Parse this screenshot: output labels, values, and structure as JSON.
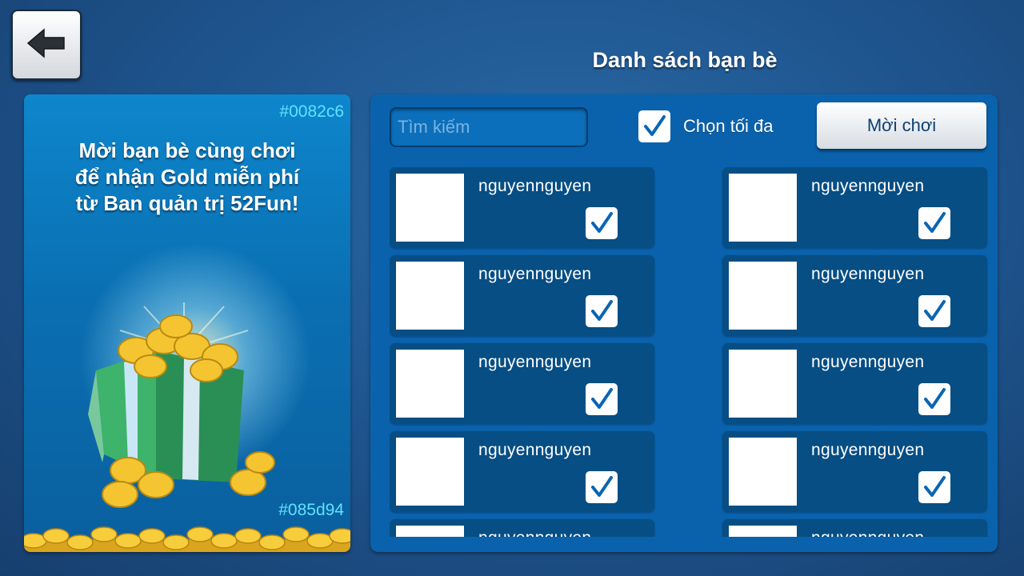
{
  "header": {
    "title": "Danh sách bạn bè",
    "back_icon": "arrow-left-icon"
  },
  "promo": {
    "hex_top": "#0082c6",
    "hex_bottom": "#085d94",
    "message_lines": [
      "Mời bạn bè cùng chơi",
      "để nhận Gold miễn phí",
      "từ Ban quản trị 52Fun!"
    ],
    "illustration": "gift-box-with-gold-coins"
  },
  "toolbar": {
    "search_placeholder": "Tìm kiếm",
    "select_all_label": "Chọn tối đa",
    "select_all_checked": true,
    "invite_label": "Mời chơi"
  },
  "colors": {
    "background": "#1f5690",
    "panel": "#0a62ad",
    "card": "#064e84",
    "check": "#0a65b5",
    "hex_text": "#5fe3ff"
  },
  "friends": [
    {
      "name": "nguyennguyen",
      "checked": true
    },
    {
      "name": "nguyennguyen",
      "checked": true
    },
    {
      "name": "nguyennguyen",
      "checked": true
    },
    {
      "name": "nguyennguyen",
      "checked": true
    },
    {
      "name": "nguyennguyen",
      "checked": true
    },
    {
      "name": "nguyennguyen",
      "checked": true
    },
    {
      "name": "nguyennguyen",
      "checked": true
    },
    {
      "name": "nguyennguyen",
      "checked": true
    },
    {
      "name": "nguyennguyen",
      "checked": true
    },
    {
      "name": "nguyennguyen",
      "checked": true
    }
  ]
}
